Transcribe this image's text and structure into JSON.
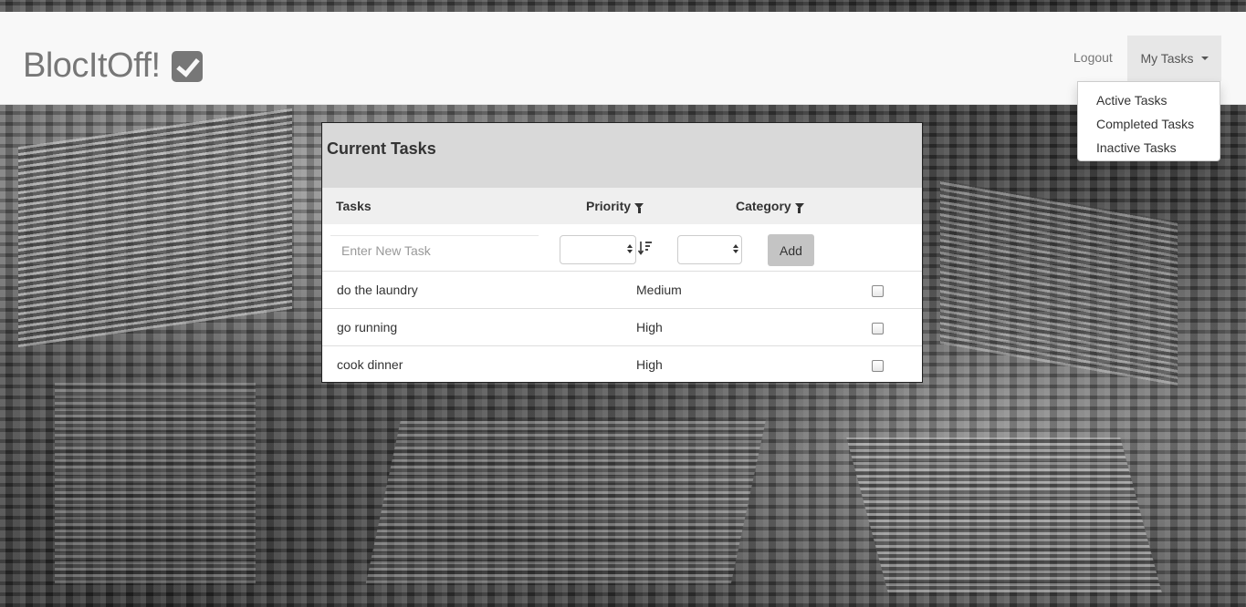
{
  "navbar": {
    "brand": "BlocItOff!",
    "logout_label": "Logout",
    "my_tasks_label": "My Tasks"
  },
  "dropdown": {
    "items": [
      {
        "label": "Active Tasks"
      },
      {
        "label": "Completed Tasks"
      },
      {
        "label": "Inactive Tasks"
      }
    ]
  },
  "panel": {
    "title": "Current Tasks",
    "columns": {
      "tasks": "Tasks",
      "priority": "Priority",
      "category": "Category"
    },
    "new_task_placeholder": "Enter New Task",
    "add_label": "Add",
    "rows": [
      {
        "task": "do the laundry",
        "priority": "Medium"
      },
      {
        "task": "go running",
        "priority": "High"
      },
      {
        "task": "cook dinner",
        "priority": "High"
      }
    ]
  },
  "colors": {
    "navbar_bg": "#f8f8f8",
    "active_nav_bg": "#e7e7e7",
    "panel_heading_bg": "#d9d9d9",
    "add_button_bg": "#c4c4c4"
  }
}
